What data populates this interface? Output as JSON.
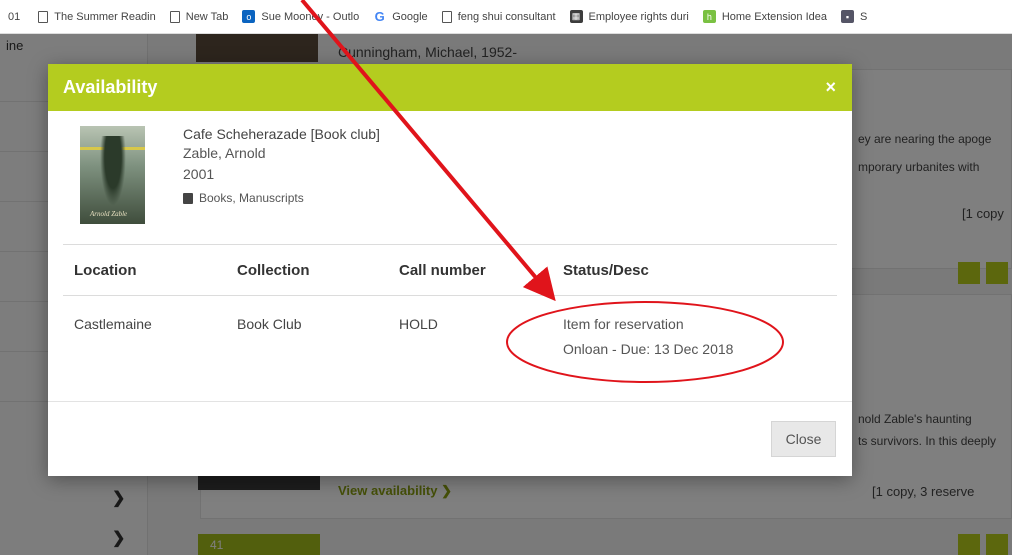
{
  "bookmarks": [
    {
      "label": "01",
      "icon": "none"
    },
    {
      "label": "The Summer Readin",
      "icon": "document-icon"
    },
    {
      "label": "New Tab",
      "icon": "document-icon"
    },
    {
      "label": "Sue Mooney - Outlo",
      "icon": "outlook-icon"
    },
    {
      "label": "Google",
      "icon": "google-icon"
    },
    {
      "label": "feng shui consultant",
      "icon": "document-icon"
    },
    {
      "label": "Employee rights duri",
      "icon": "calendar-icon"
    },
    {
      "label": "Home Extension Idea",
      "icon": "houzz-icon"
    },
    {
      "label": "S",
      "icon": "site-icon"
    }
  ],
  "background": {
    "left_label": "ine",
    "author_line": "Cunningham, Michael, 1952-",
    "desc_top_1": "ey are nearing the apoge",
    "desc_top_2": "mporary urbanites with",
    "copies_top": "[1 copy",
    "desc_mid_1": "nold Zable's haunting",
    "desc_mid_2": "ts survivors. In this deeply",
    "view_availability": "View availability ❯",
    "copies_bottom": "[1 copy, 3 reserve",
    "bottom_bar_text": "41"
  },
  "modal": {
    "title": "Availability",
    "close_x": "×",
    "book": {
      "title": "Cafe Scheherazade [Book club]",
      "author": "Zable, Arnold",
      "year": "2001",
      "format": "Books, Manuscripts",
      "cover_caption": "Arnold Zable"
    },
    "table": {
      "headers": {
        "location": "Location",
        "collection": "Collection",
        "call_number": "Call number",
        "status": "Status/Desc"
      },
      "rows": [
        {
          "location": "Castlemaine",
          "collection": "Book Club",
          "call_number": "HOLD",
          "status": [
            "Item for reservation",
            "Onloan - Due: 13 Dec 2018"
          ]
        }
      ]
    },
    "close_button": "Close"
  },
  "colors": {
    "accent": "#b4cc1f",
    "annotation": "#e0141b"
  }
}
